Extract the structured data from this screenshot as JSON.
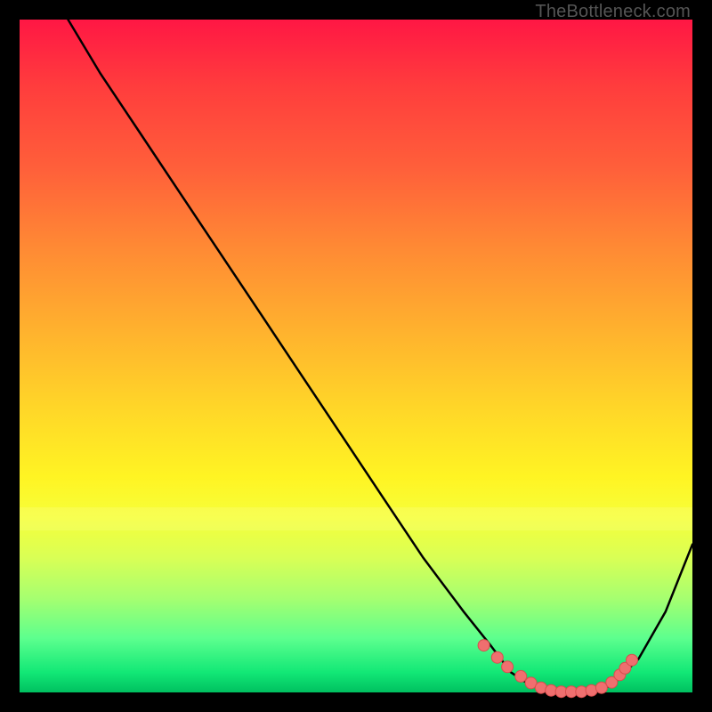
{
  "watermark": "TheBottleneck.com",
  "colors": {
    "curve": "#000000",
    "dot_fill": "#ef6f6f",
    "dot_stroke": "#d94d4d",
    "frame": "#000000"
  },
  "chart_data": {
    "type": "line",
    "title": "",
    "xlabel": "",
    "ylabel": "",
    "xlim": [
      0,
      100
    ],
    "ylim": [
      0,
      100
    ],
    "grid": false,
    "series": [
      {
        "name": "bottleneck-curve",
        "x": [
          0,
          6,
          12,
          18,
          24,
          30,
          36,
          42,
          48,
          54,
          60,
          66,
          70,
          73,
          76,
          80,
          84,
          88,
          92,
          96,
          100
        ],
        "values": [
          112,
          102,
          92,
          83,
          74,
          65,
          56,
          47,
          38,
          29,
          20,
          12,
          7,
          3,
          1,
          0,
          0,
          1,
          5,
          12,
          22
        ]
      }
    ],
    "optimal_points": {
      "x": [
        69.0,
        71.0,
        72.5,
        74.5,
        76.0,
        77.5,
        79.0,
        80.5,
        82.0,
        83.5,
        85.0,
        86.5,
        88.0,
        89.2,
        90.0,
        91.0
      ],
      "values": [
        7.0,
        5.2,
        3.8,
        2.4,
        1.4,
        0.7,
        0.3,
        0.1,
        0.1,
        0.1,
        0.3,
        0.7,
        1.5,
        2.6,
        3.6,
        4.8
      ]
    }
  }
}
